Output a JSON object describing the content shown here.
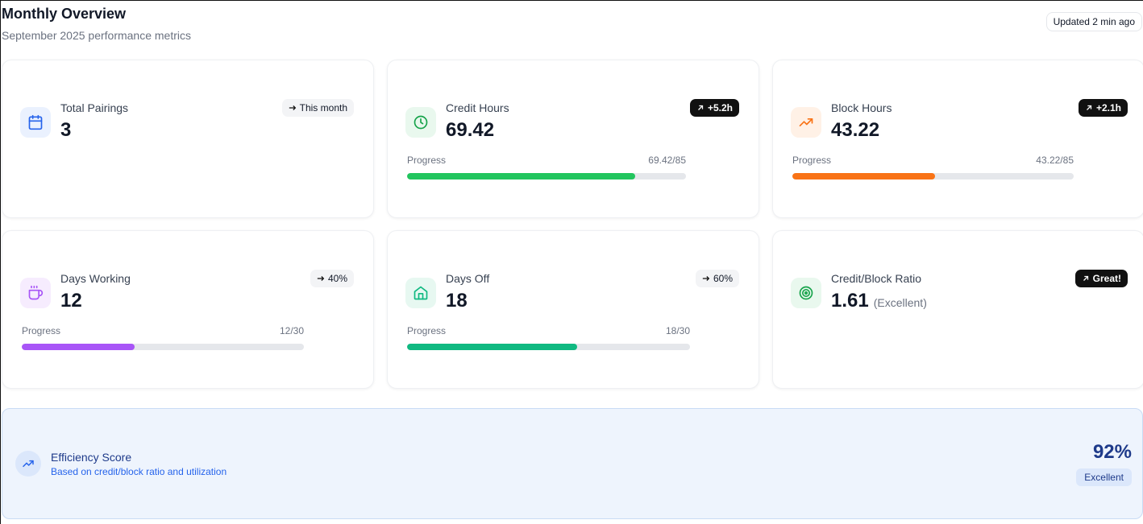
{
  "header": {
    "title": "Monthly Overview",
    "subtitle": "September 2025 performance metrics",
    "updated": "Updated 2 min ago"
  },
  "cards": {
    "total_pairings": {
      "label": "Total Pairings",
      "value": "3",
      "badge": "This month",
      "icon": "calendar-icon"
    },
    "credit_hours": {
      "label": "Credit Hours",
      "value": "69.42",
      "badge": "+5.2h",
      "icon": "clock-icon",
      "progress_label": "Progress",
      "progress_text": "69.42/85",
      "progress": 0.8167
    },
    "block_hours": {
      "label": "Block Hours",
      "value": "43.22",
      "badge": "+2.1h",
      "icon": "trending-up-icon",
      "progress_label": "Progress",
      "progress_text": "43.22/85",
      "progress": 0.5085
    },
    "days_working": {
      "label": "Days Working",
      "value": "12",
      "badge": "40%",
      "icon": "coffee-icon",
      "progress_label": "Progress",
      "progress_text": "12/30",
      "progress": 0.4
    },
    "days_off": {
      "label": "Days Off",
      "value": "18",
      "badge": "60%",
      "icon": "home-icon",
      "progress_label": "Progress",
      "progress_text": "18/30",
      "progress": 0.6
    },
    "ratio": {
      "label": "Credit/Block Ratio",
      "value": "1.61",
      "note": "(Excellent)",
      "badge": "Great!",
      "icon": "target-icon"
    }
  },
  "efficiency": {
    "title": "Efficiency Score",
    "subtitle": "Based on credit/block ratio and utilization",
    "score": "92%",
    "rating": "Excellent",
    "icon": "trending-up-icon"
  },
  "colors": {
    "blue": "#2563eb",
    "green": "#16a34a",
    "green_bar": "#22c55e",
    "orange": "#f97316",
    "purple": "#a855f7",
    "emerald": "#10b981",
    "navy": "#1e3a8a"
  }
}
